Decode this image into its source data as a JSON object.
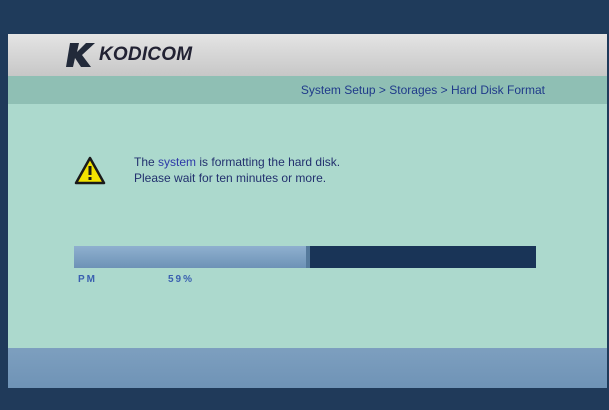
{
  "brand": {
    "name": "KODICOM",
    "logo_icon": "kodicom-k-logo-icon"
  },
  "breadcrumb": "System Setup > Storages > Hard Disk Format",
  "message": {
    "line1_before": "The ",
    "line1_highlight": "system",
    "line1_after": " is formatting the hard disk.",
    "line2": "Please wait for ten minutes or more."
  },
  "warning_icon": "warning-triangle-icon",
  "progress": {
    "fraction": 0.51,
    "left_label": "PM",
    "percent_label": "59%"
  },
  "colors": {
    "accent": "#1f3a8a",
    "progress_track": "#193457",
    "progress_fill": "#7fa3c6",
    "warning": "#f2e300"
  }
}
